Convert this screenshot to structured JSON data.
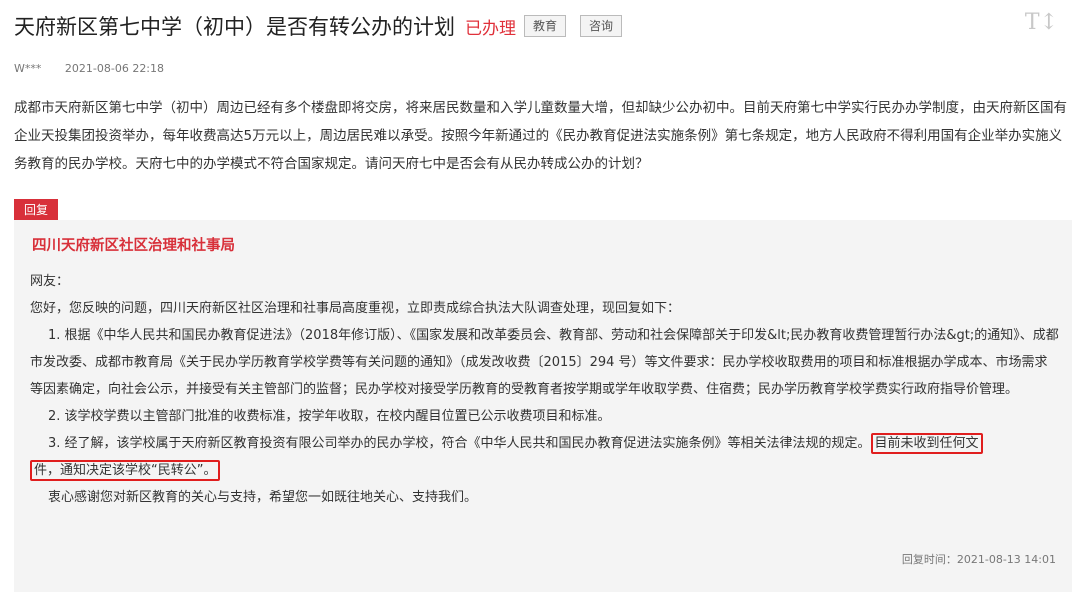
{
  "header": {
    "title": "天府新区第七中学（初中）是否有转公办的计划",
    "status": "已办理",
    "tags": [
      "教育",
      "咨询"
    ],
    "font_toggle": "T↕"
  },
  "meta": {
    "author": "W***",
    "datetime": "2021-08-06 22:18"
  },
  "question": "成都市天府新区第七中学（初中）周边已经有多个楼盘即将交房，将来居民数量和入学儿童数量大增，但却缺少公办初中。目前天府第七中学实行民办办学制度，由天府新区国有企业天投集团投资举办，每年收费高达5万元以上，周边居民难以承受。按照今年新通过的《民办教育促进法实施条例》第七条规定，地方人民政府不得利用国有企业举办实施义务教育的民办学校。天府七中的办学模式不符合国家规定。请问天府七中是否会有从民办转成公办的计划？",
  "reply": {
    "badge": "回复",
    "department": "四川天府新区社区治理和社事局",
    "greeting": "网友：",
    "intro": "您好，您反映的问题，四川天府新区社区治理和社事局高度重视，立即责成综合执法大队调查处理，现回复如下：",
    "item1": "1. 根据《中华人民共和国民办教育促进法》（2018年修订版）、《国家发展和改革委员会、教育部、劳动和社会保障部关于印发&lt;民办教育收费管理暂行办法&gt;的通知》、成都市发改委、成都市教育局《关于民办学历教育学校学费等有关问题的通知》（成发改收费〔2015〕294 号）等文件要求：民办学校收取费用的项目和标准根据办学成本、市场需求等因素确定，向社会公示，并接受有关主管部门的监督；民办学校对接受学历教育的受教育者按学期或学年收取学费、住宿费；民办学历教育学校学费实行政府指导价管理。",
    "item2": "2. 该学校学费以主管部门批准的收费标准，按学年收取，在校内醒目位置已公示收费项目和标准。",
    "item3_lead": "3. 经了解，该学校属于天府新区教育投资有限公司举办的民办学校，符合《中华人民共和国民办教育促进法实施条例》等相关法律法规的规定。",
    "item3_highlight_a": "目前未收到任何文",
    "item3_highlight_b": "件，通知决定该学校“民转公”。",
    "closing": "衷心感谢您对新区教育的关心与支持，希望您一如既往地关心、支持我们。",
    "time_label": "回复时间：",
    "time": "2021-08-13 14:01"
  }
}
